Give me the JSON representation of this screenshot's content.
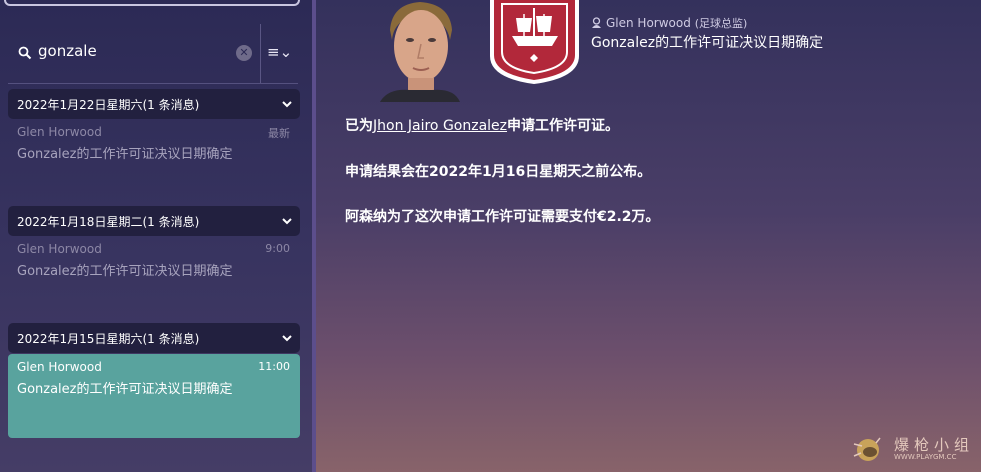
{
  "search": {
    "query": "gonzale"
  },
  "groups": [
    {
      "title": "2022年1月22日星期六(1 条消息)",
      "message": {
        "sender": "Glen Horwood",
        "time": "最新",
        "subject": "Gonzalez的工作许可证决议日期确定"
      }
    },
    {
      "title": "2022年1月18日星期二(1 条消息)",
      "message": {
        "sender": "Glen Horwood",
        "time": "9:00",
        "subject": "Gonzalez的工作许可证决议日期确定"
      }
    },
    {
      "title": "2022年1月15日星期六(1 条消息)",
      "message": {
        "sender": "Glen Horwood",
        "time": "11:00",
        "subject": "Gonzalez的工作许可证决议日期确定"
      }
    }
  ],
  "message": {
    "sender": "Glen Horwood",
    "role": "(足球总监)",
    "title": "Gonzalez的工作许可证决议日期确定",
    "line1_prefix": "已为",
    "player": "Jhon Jairo Gonzalez",
    "line1_suffix": "申请工作许可证。",
    "line2": "申请结果会在2022年1月16日星期天之前公布。",
    "line3": "阿森纳为了这次申请工作许可证需要支付€2.2万。"
  },
  "watermark": {
    "text": "爆枪小组",
    "url": "WWW.PLAYGM.CC"
  },
  "colors": {
    "selected_item": "#59a39e",
    "crest_red": "#b2283a",
    "sidebar_bg": "#2c2a55",
    "group_header_bg": "#22203f"
  }
}
